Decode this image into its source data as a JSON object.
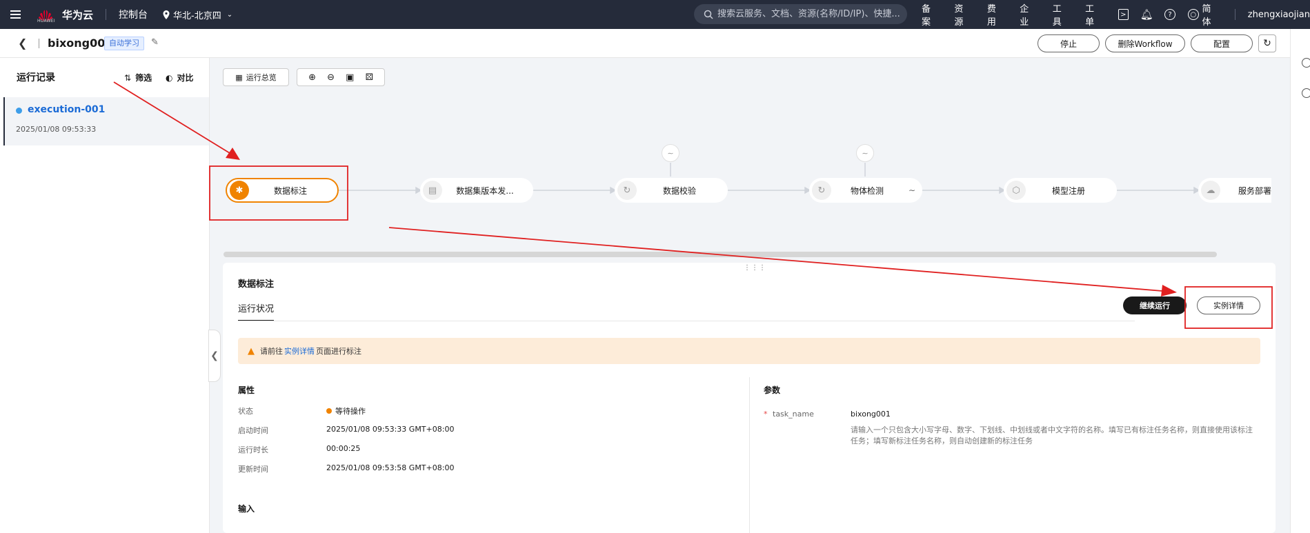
{
  "topbar": {
    "menu_icon": "menu-icon",
    "brand": "华为云",
    "brand_sub": "HUAWEI",
    "console": "控制台",
    "region": "华北-北京四",
    "search_placeholder": "搜索云服务、文档、资源(名称/ID/IP)、快捷...",
    "links": [
      "备案",
      "资源",
      "费用",
      "企业",
      "工具",
      "工单"
    ],
    "language": "简体",
    "user": "zhengxiaojian"
  },
  "header": {
    "workflow_name": "bixong001",
    "tag": "自动学习",
    "buttons": {
      "stop": "停止",
      "delete": "删除Workflow",
      "config": "配置"
    }
  },
  "left_panel": {
    "title": "运行记录",
    "filter": "筛选",
    "compare": "对比",
    "executions": [
      {
        "name": "execution-001",
        "time": "2025/01/08 09:53:33"
      }
    ]
  },
  "canvas": {
    "overview_btn": "运行总览",
    "zoom_tools": [
      "zoom-in-icon",
      "zoom-out-icon",
      "fit-screen-icon",
      "layout-icon"
    ],
    "nodes": [
      {
        "label": "数据标注",
        "state": "active"
      },
      {
        "label": "数据集版本发...",
        "state": "pending"
      },
      {
        "label": "数据校验",
        "state": "pending"
      },
      {
        "label": "物体检测",
        "state": "pending"
      },
      {
        "label": "模型注册",
        "state": "pending"
      },
      {
        "label": "服务部署",
        "state": "pending"
      }
    ]
  },
  "detail": {
    "title": "数据标注",
    "tab": "运行状况",
    "btn_continue": "继续运行",
    "btn_instance": "实例详情",
    "alert": {
      "pre": "请前往",
      "link": "实例详情",
      "post": "页面进行标注"
    },
    "attributes_title": "属性",
    "attributes": [
      {
        "k": "状态",
        "v": "等待操作"
      },
      {
        "k": "启动时间",
        "v": "2025/01/08 09:53:33 GMT+08:00"
      },
      {
        "k": "运行时长",
        "v": "00:00:25"
      },
      {
        "k": "更新时间",
        "v": "2025/01/08 09:53:58 GMT+08:00"
      }
    ],
    "input_title": "输入",
    "params_title": "参数",
    "param": {
      "key": "task_name",
      "value": "bixong001",
      "desc": "请输入一个只包含大小写字母、数字、下划线、中划线或者中文字符的名称。填写已有标注任务名称，则直接使用该标注任务；填写新标注任务名称，则自动创建新的标注任务"
    }
  },
  "colors": {
    "topbar_bg": "#252b3a",
    "accent_orange": "#f08300",
    "link_blue": "#1b6bd6",
    "annotation_red": "#e02020"
  }
}
